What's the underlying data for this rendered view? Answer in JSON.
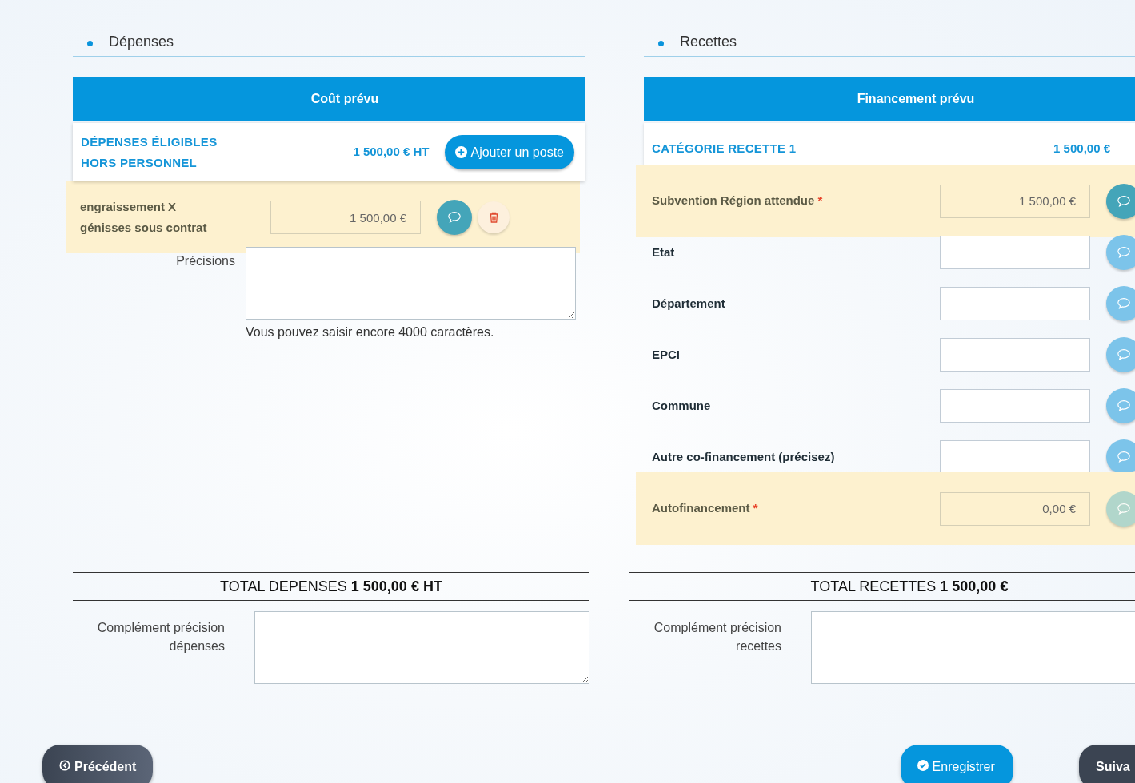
{
  "depenses": {
    "title": "Dépenses",
    "header": "Coût prévu",
    "category": {
      "label": "DÉPENSES ÉLIGIBLES HORS PERSONNEL",
      "amount": "1 500,00 € HT",
      "add_button": "Ajouter un poste"
    },
    "items": [
      {
        "label": "engraissement X génisses sous contrat",
        "value": "1 500,00 €",
        "highlighted": true
      }
    ],
    "precisions_label": "Précisions",
    "char_counter": "Vous pouvez saisir encore 4000 caractères.",
    "total": "TOTAL DEPENSES **1 500,00 € HT**",
    "complement_label": "Complément précision dépenses"
  },
  "recettes": {
    "title": "Recettes",
    "header": "Financement prévu",
    "category": {
      "label": "CATÉGORIE RECETTE 1",
      "amount": "1 500,00 €"
    },
    "rows": [
      {
        "label": "Subvention Région attendue",
        "required_mark": "*",
        "value": "1 500,00 €",
        "highlighted": true,
        "disabled": false
      },
      {
        "label": "Etat",
        "highlighted": false,
        "disabled": false
      },
      {
        "label": "Département",
        "highlighted": false,
        "disabled": false
      },
      {
        "label": "EPCI",
        "highlighted": false,
        "disabled": false
      },
      {
        "label": "Commune",
        "highlighted": false,
        "disabled": false
      },
      {
        "label": "Autre co-financement (précisez)",
        "highlighted": false,
        "disabled": false
      },
      {
        "label": "Autofinancement",
        "required_mark": "*",
        "value": "0,00 €",
        "highlighted": true,
        "disabled": true
      }
    ],
    "total": "TOTAL RECETTES **1 500,00 €**",
    "complement_label": "Complément précision recettes"
  },
  "footer": {
    "previous": "Précédent",
    "save": "Enregistrer",
    "next": "Suiva"
  }
}
